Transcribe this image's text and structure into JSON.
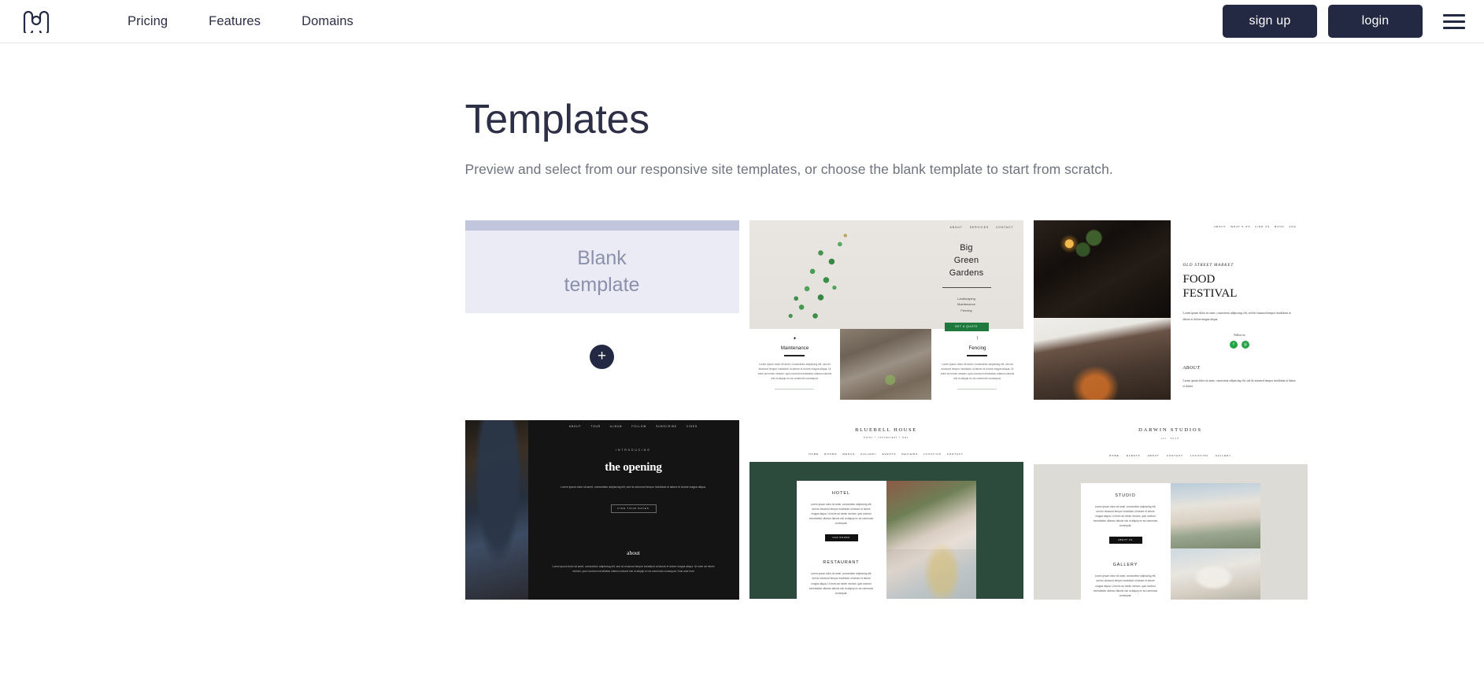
{
  "header": {
    "logo_name": "moonfruit-m-logo",
    "nav": [
      {
        "label": "Pricing"
      },
      {
        "label": "Features"
      },
      {
        "label": "Domains"
      }
    ],
    "signup_label": "sign up",
    "login_label": "login",
    "menu_icon": "hamburger-menu-icon",
    "colors": {
      "button_bg": "#232942",
      "button_text": "#ffffff",
      "text": "#2c2f45"
    }
  },
  "main": {
    "title": "Templates",
    "subtitle": "Preview and select from our responsive site templates, or choose the blank template to start from scratch."
  },
  "templates": {
    "blank": {
      "line1": "Blank",
      "line2": "template",
      "add_label": "+",
      "colors": {
        "bar": "#c2c6dd",
        "body": "#eaebf5",
        "text": "#8b90ab",
        "add_bg": "#232942"
      }
    },
    "gardens": {
      "nav": [
        "ABOUT",
        "SERVICES",
        "CONTACT"
      ],
      "title_lines": [
        "Big",
        "Green",
        "Gardens"
      ],
      "services": [
        "Landscaping",
        "Maintenance",
        "Fencing"
      ],
      "cta": "GET A QUOTE",
      "cta_color": "#1e7a3c",
      "col_left": {
        "icon": "✦",
        "heading": "Maintenance",
        "text": "Lorem ipsum dolor sit amet, consectetur adipiscing elit, sed do eiusmod tempor incididunt ut labore et dolore magna aliqua. Ut enim ad minim veniam, quis nostrud exercitation ullamco laboris nisi ut aliquip ex ea commodo consequat."
      },
      "col_right": {
        "icon": "⊺",
        "heading": "Fencing",
        "text": "Lorem ipsum dolor sit amet, consectetur adipiscing elit, sed do eiusmod tempor incididunt ut labore et dolore magna aliqua. Ut enim ad minim veniam, quis nostrud exercitation ullamco laboris nisi ut aliquip ex ea commodo consequat."
      }
    },
    "food": {
      "nav": [
        "ABOUT",
        "WHAT'S ON",
        "FIND US",
        "BOOK",
        "FAQ"
      ],
      "kicker": "OLD STREET MARKET",
      "title_lines": [
        "FOOD",
        "FESTIVAL"
      ],
      "lorem": "Lorem ipsum dolor sit amet, consectetur adipiscing elit, sed do eiusmod tempor incididunt ut labore et dolore magna aliqua.",
      "follow_label": "Follow us",
      "socials": [
        "f",
        "◎"
      ],
      "about_heading": "ABOUT",
      "about_text": "Lorem ipsum dolor sit amet, consectetur adipiscing elit, sed do eiusmod tempor incididunt ut labore et dolore",
      "social_color": "#25a244"
    },
    "opening": {
      "nav": [
        "ABOUT",
        "TOUR",
        "ALBUM",
        "FOLLOW",
        "SUBSCRIBE",
        "VIDEO"
      ],
      "kicker": "INTRODUCING",
      "title": "the opening",
      "lorem": "Lorem ipsum dolor sit amet, consectetur adipiscing elit, sed do eiusmod tempor incididunt ut labore et dolore magna aliqua.",
      "cta": "FIND TOUR DATES",
      "about_heading": "about",
      "about_text": "Lorem ipsum dolor sit amet, consectetur adipiscing elit, sed do eiusmod tempor incididunt ut labore et dolore magna aliqua. Ut enim ad minim veniam, quis nostrud exercitation ullamco laboris nisi ut aliquip ex ea commodo consequat. Duis aute irure"
    },
    "bluebell": {
      "logo": "BLUEBELL HOUSE",
      "tagline": "hotel + restaurant + bar",
      "nav": [
        "HOME",
        "ROOMS",
        "MENUS",
        "GALLERY",
        "EVENTS",
        "REVIEWS",
        "LOCATION",
        "CONTACT"
      ],
      "section1": {
        "heading": "HOTEL",
        "text": "Lorem ipsum dolor sit amet, consectetur adipiscing elit, sed do eiusmod tempor incididunt ut labore et dolore magna aliqua. Ut enim ad minim veniam, quis nostrud exercitation ullamco laboris nisi ut aliquip ex ea commodo consequat.",
        "button": "OUR ROOMS"
      },
      "section2": {
        "heading": "RESTAURANT",
        "text": "Lorem ipsum dolor sit amet, consectetur adipiscing elit, sed do eiusmod tempor incididunt ut labore et dolore magna aliqua. Ut enim ad minim veniam, quis nostrud exercitation ullamco laboris nisi ut aliquip ex ea commodo consequat."
      },
      "bg_color": "#2c4b3d"
    },
    "darwin": {
      "logo": "DARWIN STUDIOS",
      "est": "est. 2015",
      "nav": [
        "HOME",
        "EVENTS",
        "ABOUT",
        "CONTACT",
        "LOCATION",
        "GALLERY"
      ],
      "section1": {
        "heading": "STUDIO",
        "text": "Lorem ipsum dolor sit amet, consectetur adipiscing elit, sed do eiusmod tempor incididunt ut labore et dolore magna aliqua. Ut enim ad minim veniam, quis nostrud exercitation ullamco laboris nisi ut aliquip ex ea commodo consequat.",
        "button": "ABOUT US"
      },
      "section2": {
        "heading": "GALLERY",
        "text": "Lorem ipsum dolor sit amet, consectetur adipiscing elit, sed do eiusmod tempor incididunt ut labore et dolore magna aliqua. Ut enim ad minim veniam, quis nostrud exercitation ullamco laboris nisi ut aliquip ex ea commodo consequat."
      },
      "bg_color": "#dcdbd6"
    }
  }
}
